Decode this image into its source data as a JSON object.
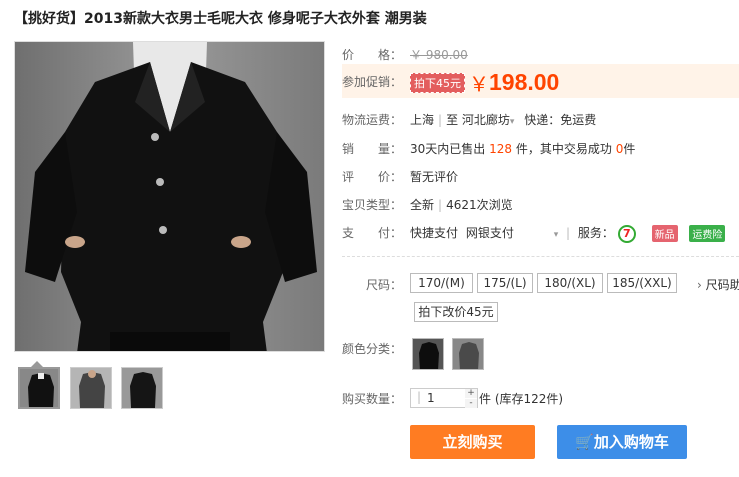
{
  "product": {
    "title": "【挑好货】2013新款大衣男士毛呢大衣 修身呢子大衣外套 潮男装"
  },
  "price": {
    "label": "价　　格：",
    "original": "￥ 980.00",
    "promo_label": "参加促销：",
    "promo_tag": "拍下45元",
    "currency": "￥",
    "current": "198.00"
  },
  "shipping": {
    "label": "物流运费：",
    "from": "上海",
    "divider": "至",
    "to": "河北廊坊",
    "method": "快递：免运费"
  },
  "sales": {
    "label": "销　　量：",
    "prefix": "30天内已售出",
    "count": "128",
    "middle": "件，其中交易成功",
    "success": "0",
    "suffix": "件"
  },
  "review": {
    "label": "评　　价：",
    "value": "暂无评价"
  },
  "item_type": {
    "label": "宝贝类型：",
    "value": "全新",
    "views": "4621次浏览"
  },
  "payment": {
    "label": "支　　付：",
    "methods": "快捷支付",
    "bank": "网银支付",
    "service_label": "服务：",
    "service_icon": "7",
    "badge_new": "新品",
    "badge_ship": "运费险"
  },
  "options": {
    "size_label": "尺码：",
    "sizes": [
      "170/(M)",
      "175/(L)",
      "180/(XL)",
      "185/(XXL)"
    ],
    "size_link": "尺码助",
    "note": "拍下改价45元",
    "color_label": "颜色分类：",
    "qty_label": "购买数量：",
    "qty_value": "1",
    "stock": "件 (库存122件)"
  },
  "actions": {
    "buy_now": "立刻购买",
    "add_cart": "加入购物车"
  },
  "colors": {
    "price": "#ff4400",
    "buy": "#ff7c22",
    "cart": "#3d8ee8"
  }
}
